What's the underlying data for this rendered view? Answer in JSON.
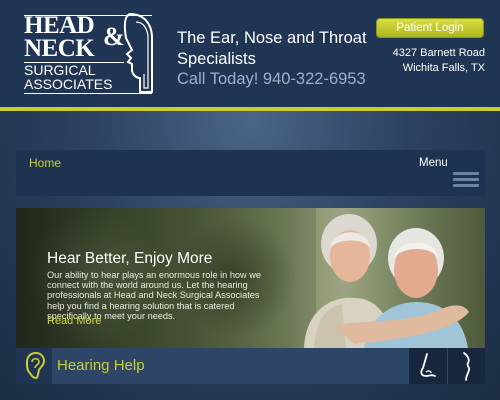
{
  "header": {
    "logo": {
      "line1": "HEAD",
      "line2": "NECK",
      "amp": "&",
      "line3": "SURGICAL",
      "line4": "ASSOCIATES"
    },
    "tagline": "The Ear, Nose and Throat Specialists",
    "phone": "Call Today! 940-322-6953",
    "portal_button": "Patient Login",
    "address_line1": "4327 Barnett Road",
    "address_line2": "Wichita Falls, TX"
  },
  "nav": {
    "home": "Home",
    "menu_label": "Menu"
  },
  "hero": {
    "title": "Hear Better, Enjoy More",
    "body": "Our ability to hear plays an enormous role in how we connect with the world around us. Let the hearing professionals at Head and Neck Surgical Associates help you find a hearing solution that is catered specifically to meet your needs.",
    "read_more": "Read More"
  },
  "specialty_bar": {
    "active_label": "Hearing Help",
    "icons": [
      "ear-icon",
      "nose-icon",
      "throat-icon"
    ]
  },
  "colors": {
    "accent": "#c8cf2d",
    "header_bg": "#1f3553",
    "bar_bg": "#2d4567"
  }
}
